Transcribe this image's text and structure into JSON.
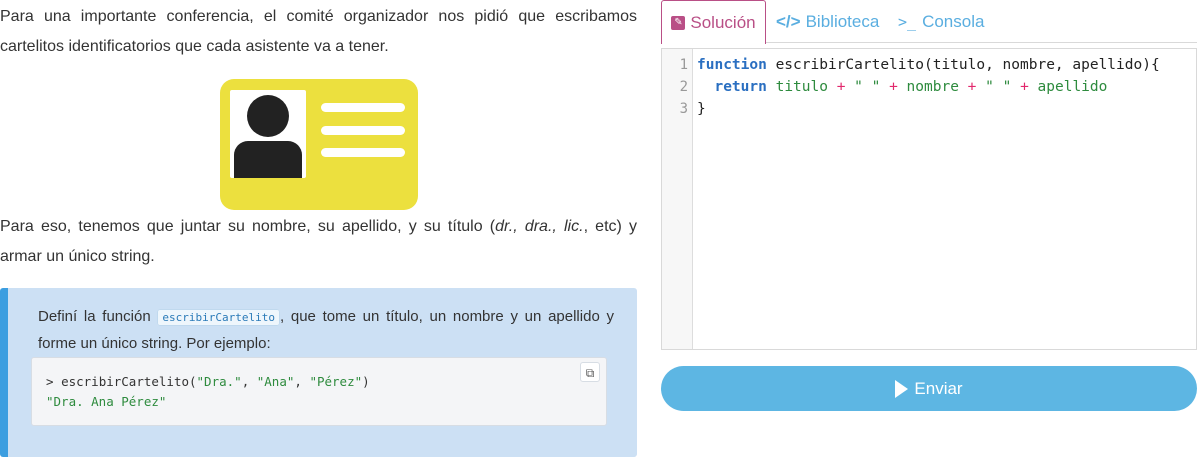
{
  "intro": {
    "paragraph1": "Para una importante conferencia, el comité organizador nos pidió que escribamos cartelitos identificatorios que cada asistente va a tener.",
    "paragraph2_prefix": "Para eso, tenemos que juntar su nombre, su apellido, y su título (",
    "paragraph2_examples": "dr., dra., lic.",
    "paragraph2_suffix": ", etc) y armar un único string."
  },
  "card_icon": "id-badge-illustration",
  "task": {
    "prefix": "Definí la función ",
    "function_name": "escribirCartelito",
    "suffix": ", que tome un título, un nombre y un apellido y forme un único string. Por ejemplo:",
    "example": {
      "prompt": "> ",
      "call": "escribirCartelito(",
      "arg1": "\"Dra.\"",
      "arg2": "\"Ana\"",
      "arg3": "\"Pérez\"",
      "sep": ", ",
      "close": ")",
      "result": "\"Dra. Ana Pérez\""
    },
    "copy_icon": "copy-icon"
  },
  "tabs": [
    {
      "label": "Solución",
      "icon": "pencil-icon",
      "active": true
    },
    {
      "label": "Biblioteca",
      "icon": "code-icon",
      "active": false
    },
    {
      "label": "Consola",
      "icon": "terminal-icon",
      "active": false
    }
  ],
  "editor": {
    "line_numbers": [
      "1",
      "2",
      "3"
    ],
    "line1": {
      "kw": "function",
      "rest": " escribirCartelito(titulo, nombre, apellido){"
    },
    "line2": {
      "indent": "  ",
      "kw": "return",
      "t1": " titulo ",
      "p1": "+",
      "s1": " \" \" ",
      "p2": "+",
      "t2": " nombre ",
      "p3": "+",
      "s2": " \" \" ",
      "p4": "+",
      "t3": " apellido"
    },
    "line3": "}"
  },
  "send_button": {
    "label": "Enviar",
    "icon": "play-icon"
  },
  "colors": {
    "accent_tab": "#b94f86",
    "link_blue": "#5aaee0",
    "send_bg": "#5db6e3",
    "callout_bg": "#cce0f4",
    "callout_border": "#3c9ee0",
    "card_yellow": "#ece03e"
  }
}
